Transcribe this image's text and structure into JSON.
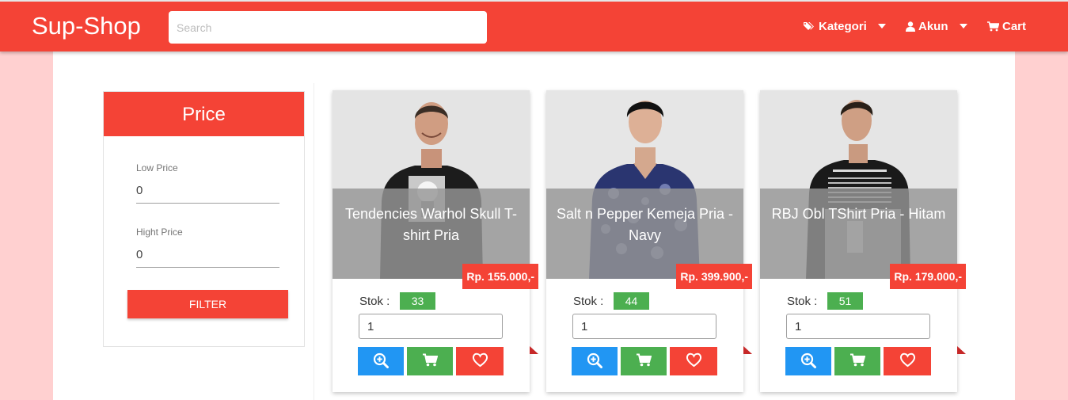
{
  "navbar": {
    "brand": "Sup-Shop",
    "search_placeholder": "Search",
    "kategori_label": "Kategori",
    "akun_label": "Akun",
    "cart_label": "Cart",
    "color": "#f44336"
  },
  "filter": {
    "title": "Price",
    "low_label": "Low Price",
    "low_value": "0",
    "high_label": "Hight Price",
    "high_value": "0",
    "button_label": "FILTER"
  },
  "products": [
    {
      "name": "Tendencies Warhol Skull T-shirt Pria",
      "price": "Rp. 155.000,-",
      "stok_label": "Stok :",
      "stok": "33",
      "qty": "1",
      "shirt_color": "#1c1c1c",
      "print": "skull"
    },
    {
      "name": "Salt n Pepper Kemeja Pria - Navy",
      "price": "Rp. 399.900,-",
      "stok_label": "Stok :",
      "stok": "44",
      "qty": "1",
      "shirt_color": "#2a3570",
      "print": "batik"
    },
    {
      "name": "RBJ Obl TShirt Pria - Hitam",
      "price": "Rp. 179.000,-",
      "stok_label": "Stok :",
      "stok": "51",
      "qty": "1",
      "shirt_color": "#1a1a1a",
      "print": "apollo"
    }
  ],
  "icons": {
    "detail": "zoom-in-icon",
    "cart": "cart-icon",
    "wishlist": "heart-icon"
  },
  "colors": {
    "accent": "#f44336",
    "stok_badge": "#4caf50",
    "detail_button": "#2196f3",
    "cart_button": "#4caf50",
    "wishlist_button": "#f44336",
    "page_side": "#ffd0d0"
  }
}
